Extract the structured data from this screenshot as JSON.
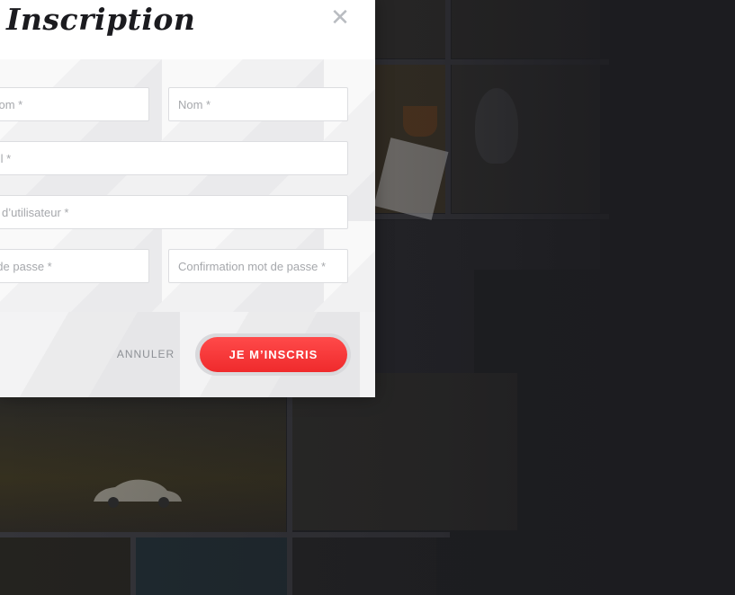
{
  "modal": {
    "title": "Inscription",
    "close_icon": "close-icon",
    "fields": {
      "first_name_placeholder": "Prénom *",
      "last_name_placeholder": "Nom *",
      "email_placeholder": "Email *",
      "username_placeholder": "Nom d’utilisateur *",
      "password_placeholder": "Mot de passe *",
      "confirm_password_placeholder": "Confirmation mot de passe *"
    },
    "actions": {
      "cancel_label": "ANNULER",
      "submit_label": "JE M’INSCRIS"
    }
  },
  "colors": {
    "accent": "#f5313a",
    "overlay": "#1f2023"
  }
}
